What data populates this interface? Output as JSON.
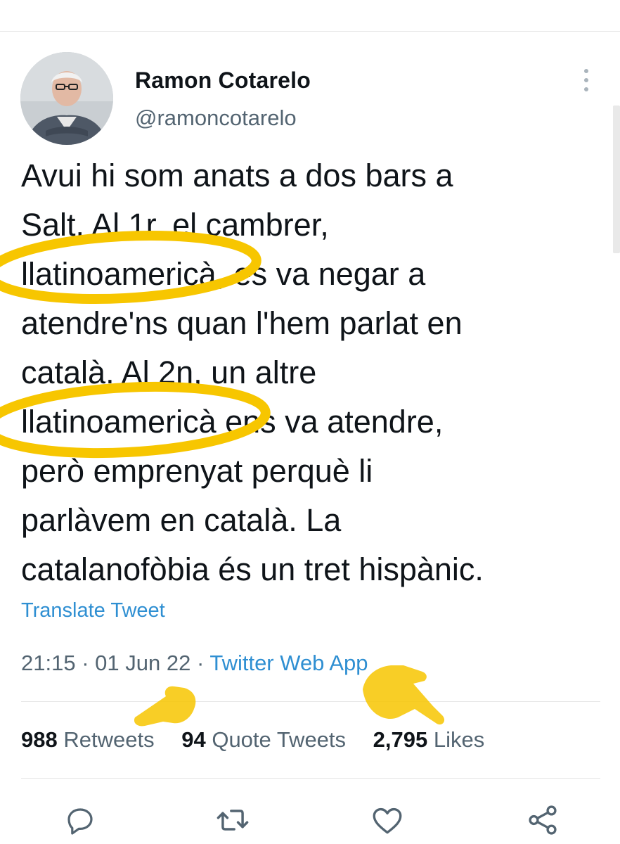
{
  "author": {
    "name": "Ramon Cotarelo",
    "handle": "@ramoncotarelo"
  },
  "tweet": {
    "text": "Avui hi som anats a dos bars a\nSalt. Al 1r, el cambrer,\nllatinoamericà, es va negar a\natendre'ns quan l'hem parlat en\ncatalà. Al 2n, un altre\nllatinoamericà ens va atendre,\nperò emprenyat perquè li\nparlàvem en català. La\ncatalanofòbia és un tret hispànic.",
    "translate_label": "Translate Tweet",
    "time": "21:15",
    "date": "01 Jun 22",
    "separator": "·",
    "source": "Twitter Web App"
  },
  "stats": {
    "retweets_count": "988",
    "retweets_label": "Retweets",
    "quotes_count": "94",
    "quotes_label": "Quote Tweets",
    "likes_count": "2,795",
    "likes_label": "Likes"
  },
  "icons": {
    "reply": "reply-icon",
    "retweet": "retweet-icon",
    "like": "heart-icon",
    "share": "share-icon",
    "more": "more-options-icon"
  },
  "colors": {
    "link": "#2f8fd2",
    "secondary_text": "#536471",
    "primary_text": "#0f1419",
    "annotation_yellow": "#f7c600"
  }
}
